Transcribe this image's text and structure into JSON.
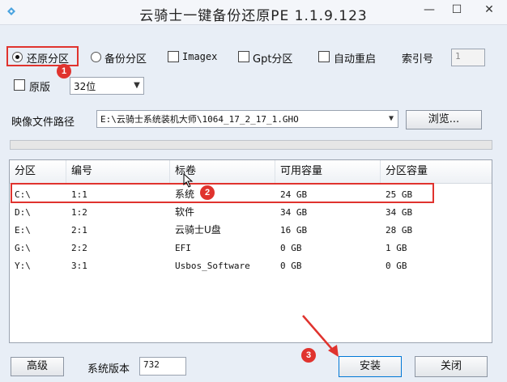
{
  "window": {
    "title": "云骑士一键备份还原PE 1.1.9.123",
    "min_glyph": "—",
    "max_glyph": "☐",
    "close_glyph": "✕"
  },
  "options": {
    "restore_label": "还原分区",
    "backup_label": "备份分区",
    "imagex_label": "Imagex",
    "gpt_label": "Gpt分区",
    "autoreboot_label": "自动重启",
    "index_label": "索引号",
    "index_value": "1",
    "original_label": "原版",
    "bits_value": "32位"
  },
  "image": {
    "label": "映像文件路径",
    "path": "E:\\云骑士系统装机大师\\1064_17_2_17_1.GHO",
    "browse_label": "浏览..."
  },
  "progress": {
    "value": 0
  },
  "table": {
    "headers": [
      "分区",
      "编号",
      "标卷",
      "可用容量",
      "分区容量"
    ],
    "rows": [
      [
        "C:\\",
        "1:1",
        "系统",
        "24 GB",
        "25 GB"
      ],
      [
        "D:\\",
        "1:2",
        "软件",
        "34 GB",
        "34 GB"
      ],
      [
        "E:\\",
        "2:1",
        "云骑士U盘",
        "16 GB",
        "28 GB"
      ],
      [
        "G:\\",
        "2:2",
        "EFI",
        "0 GB",
        "1 GB"
      ],
      [
        "Y:\\",
        "3:1",
        "Usbos_Software",
        "0 GB",
        "0 GB"
      ]
    ]
  },
  "footer": {
    "advanced_label": "高级",
    "version_label": "系统版本",
    "version_value": "732",
    "install_label": "安装",
    "close_label": "关闭"
  },
  "annotations": {
    "badge1": "1",
    "badge2": "2",
    "badge3": "3"
  },
  "colors": {
    "highlight": "#e0332e",
    "accent": "#0078d7"
  }
}
